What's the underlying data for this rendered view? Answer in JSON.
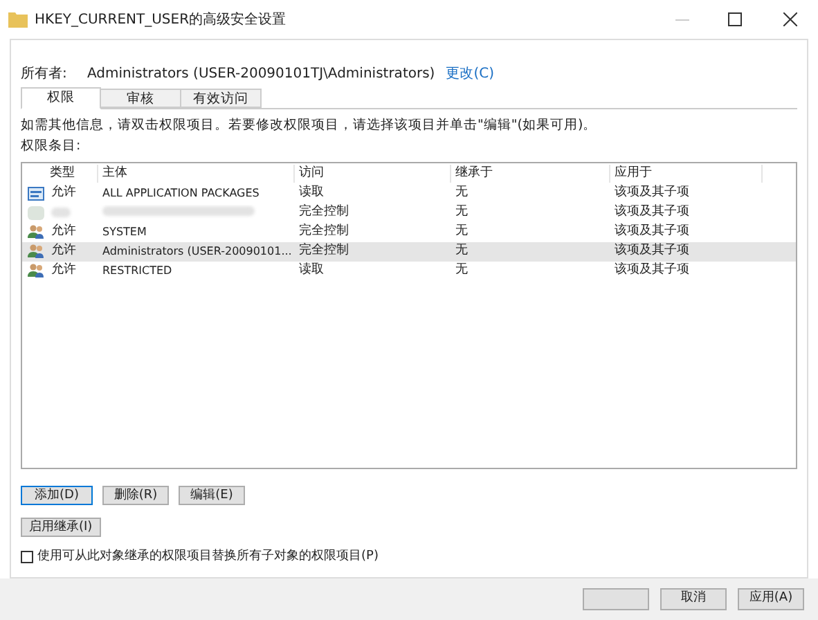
{
  "window": {
    "title": "HKEY_CURRENT_USER的高级安全设置"
  },
  "owner": {
    "label": "所有者:",
    "value": "Administrators (USER-20090101TJ\\Administrators)",
    "change_link": "更改(C)"
  },
  "tabs": [
    {
      "label": "权限",
      "selected": true
    },
    {
      "label": "审核",
      "selected": false
    },
    {
      "label": "有效访问",
      "selected": false
    }
  ],
  "info_text": "如需其他信息，请双击权限项目。若要修改权限项目，请选择该项目并单击\"编辑\"(如果可用)。",
  "entries_label": "权限条目:",
  "table": {
    "columns": [
      "类型",
      "主体",
      "访问",
      "继承于",
      "应用于"
    ],
    "rows": [
      {
        "kind": "package",
        "type": "允许",
        "principal": "ALL APPLICATION PACKAGES",
        "access": "读取",
        "inherited_from": "无",
        "applies_to": "该项及其子项",
        "selected": false
      },
      {
        "kind": "blurred",
        "access": "完全控制",
        "inherited_from": "无",
        "applies_to": "该项及其子项",
        "selected": false
      },
      {
        "kind": "group",
        "type": "允许",
        "principal": "SYSTEM",
        "access": "完全控制",
        "inherited_from": "无",
        "applies_to": "该项及其子项",
        "selected": false
      },
      {
        "kind": "group",
        "type": "允许",
        "principal": "Administrators (USER-20090101...",
        "access": "完全控制",
        "inherited_from": "无",
        "applies_to": "该项及其子项",
        "selected": true
      },
      {
        "kind": "group",
        "type": "允许",
        "principal": "RESTRICTED",
        "access": "读取",
        "inherited_from": "无",
        "applies_to": "该项及其子项",
        "selected": false
      }
    ]
  },
  "buttons": [
    "添加(D)",
    "删除(R)",
    "编辑(E)"
  ],
  "inherit_button": "启用继承(I)",
  "replace_checkbox": {
    "label": "使用可从此对象继承的权限项目替换所有子对象的权限项目(P)",
    "checked": false
  },
  "footer_buttons": [
    "取消",
    "应用(A)"
  ]
}
